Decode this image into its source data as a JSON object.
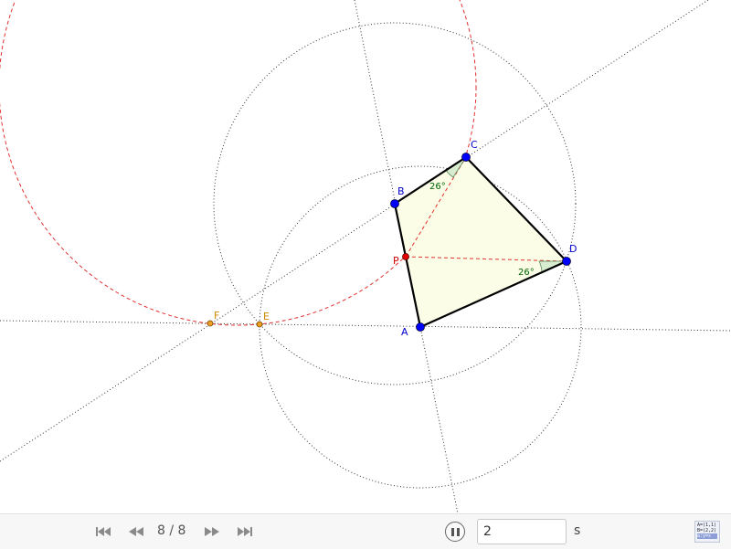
{
  "diagram": {
    "points": {
      "A": {
        "label": "A"
      },
      "B": {
        "label": "B"
      },
      "C": {
        "label": "C"
      },
      "D": {
        "label": "D"
      },
      "P": {
        "label": "P"
      },
      "E": {
        "label": "E"
      },
      "F": {
        "label": "F"
      }
    },
    "angles": {
      "at_C": "26°",
      "at_D": "26°"
    },
    "colors": {
      "polygon_fill": "#fbfde6",
      "polygon_stroke": "#000000",
      "main_point": "#0000ff",
      "p_point": "#e00000",
      "aux_point": "#e8a000",
      "red_dashed": "#e03030",
      "angle_label": "#006400",
      "point_label_blue": "#0000cc",
      "point_label_orange": "#cc8800"
    }
  },
  "navigation": {
    "step_counter": "8 / 8",
    "speed_value": "2",
    "speed_unit": "s",
    "algebra_icon_lines": [
      "A=(1,1)",
      "B=(2,2)",
      "a:y=x"
    ]
  }
}
